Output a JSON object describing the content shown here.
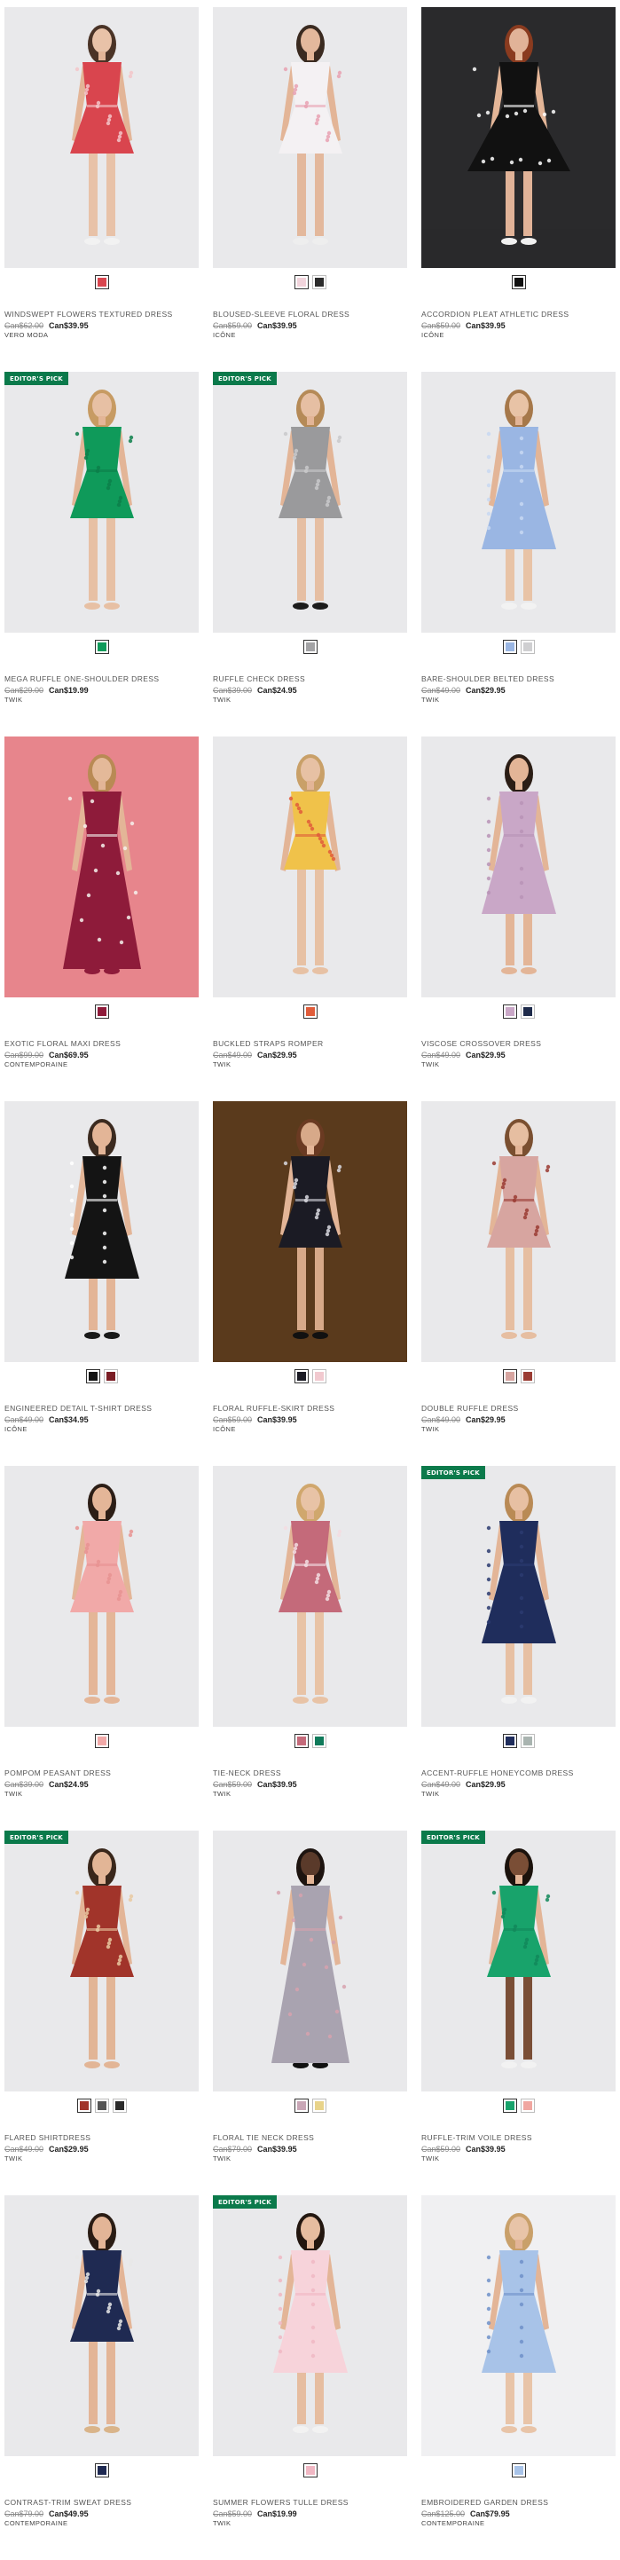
{
  "badge_label": "EDITOR'S PICK",
  "products": [
    {
      "name": "WINDSWEPT FLOWERS TEXTURED DRESS",
      "was": "Can$62.00",
      "now": "Can$39.95",
      "brand": "VERO MODA",
      "editors_pick": false,
      "photo": {
        "bg": "#e9e9eb",
        "dress": "#d9454e",
        "accent": "#f3c6c9",
        "hair": "#4a3326",
        "legs": "#e8c2a8",
        "shoes": "#f2f2f2",
        "style": "short"
      },
      "swatches": [
        "#d9454e"
      ]
    },
    {
      "name": "BLOUSED-SLEEVE FLORAL DRESS",
      "was": "Can$59.00",
      "now": "Can$39.95",
      "brand": "ICÔNE",
      "editors_pick": false,
      "photo": {
        "bg": "#e9e9eb",
        "dress": "#f4f1f3",
        "accent": "#e8a1b2",
        "hair": "#3a2a20",
        "legs": "#e3b89c",
        "shoes": "#eeeeee",
        "style": "short"
      },
      "swatches": [
        "#f1d4dc",
        "#2b2b2b"
      ]
    },
    {
      "name": "ACCORDION PLEAT ATHLETIC DRESS",
      "was": "Can$59.00",
      "now": "Can$39.95",
      "brand": "ICÔNE",
      "editors_pick": false,
      "photo": {
        "bg": "#2a2a2c",
        "dress": "#111111",
        "accent": "#ffffff",
        "hair": "#8a3b1f",
        "legs": "#e1b398",
        "shoes": "#f0f0f0",
        "style": "flare"
      },
      "swatches": [
        "#111111"
      ]
    },
    {
      "name": "MEGA RUFFLE ONE-SHOULDER DRESS",
      "was": "Can$29.00",
      "now": "Can$19.99",
      "brand": "TWIK",
      "editors_pick": true,
      "photo": {
        "bg": "#e9e9eb",
        "dress": "#0f9a5a",
        "accent": "#0c7f4a",
        "hair": "#c79b63",
        "legs": "#e7c0a4",
        "shoes": "#e7c0a4",
        "style": "short"
      },
      "swatches": [
        "#0f9a5a"
      ]
    },
    {
      "name": "RUFFLE CHECK DRESS",
      "was": "Can$39.00",
      "now": "Can$24.95",
      "brand": "TWIK",
      "editors_pick": true,
      "photo": {
        "bg": "#e9e9eb",
        "dress": "#9a9a9c",
        "accent": "#c9c9cb",
        "hair": "#b58a57",
        "legs": "#e6bfa3",
        "shoes": "#1c1c1c",
        "style": "short"
      },
      "swatches": [
        "#a3a3a5"
      ]
    },
    {
      "name": "BARE-SHOULDER BELTED DRESS",
      "was": "Can$49.00",
      "now": "Can$29.95",
      "brand": "TWIK",
      "editors_pick": false,
      "photo": {
        "bg": "#e9e9eb",
        "dress": "#9ab6e3",
        "accent": "#c8d8f2",
        "hair": "#a6784a",
        "legs": "#e8c3a6",
        "shoes": "#f2f2f2",
        "style": "midi"
      },
      "swatches": [
        "#9ab6e3",
        "#cfcfd1"
      ]
    },
    {
      "name": "EXOTIC FLORAL MAXI DRESS",
      "was": "Can$99.00",
      "now": "Can$69.95",
      "brand": "CONTEMPORAINE",
      "editors_pick": false,
      "photo": {
        "bg": "#e7858c",
        "dress": "#8e1b3a",
        "accent": "#f4f1ec",
        "hair": "#b98a54",
        "legs": "#e4b999",
        "shoes": "#8e1b3a",
        "style": "maxi"
      },
      "swatches": [
        "#8e1b3a"
      ]
    },
    {
      "name": "BUCKLED STRAPS ROMPER",
      "was": "Can$49.00",
      "now": "Can$29.95",
      "brand": "TWIK",
      "editors_pick": false,
      "photo": {
        "bg": "#e9e9eb",
        "dress": "#f0c24a",
        "accent": "#e05c3a",
        "hair": "#c9a068",
        "legs": "#e7c1a4",
        "shoes": "#e7c1a4",
        "style": "romper"
      },
      "swatches": [
        "#e05c3a"
      ]
    },
    {
      "name": "VISCOSE CROSSOVER DRESS",
      "was": "Can$49.00",
      "now": "Can$29.95",
      "brand": "TWIK",
      "editors_pick": false,
      "photo": {
        "bg": "#e9e9eb",
        "dress": "#c9a7c7",
        "accent": "#b893b6",
        "hair": "#2b1d15",
        "legs": "#e3b597",
        "shoes": "#e3b597",
        "style": "midi"
      },
      "swatches": [
        "#c9a7c7",
        "#1e2a4a"
      ]
    },
    {
      "name": "ENGINEERED DETAIL T-SHIRT DRESS",
      "was": "Can$49.00",
      "now": "Can$34.95",
      "brand": "ICÔNE",
      "editors_pick": false,
      "photo": {
        "bg": "#e9e9eb",
        "dress": "#141414",
        "accent": "#ffffff",
        "hair": "#3b2a1f",
        "legs": "#e3b597",
        "shoes": "#1a1a1a",
        "style": "midi"
      },
      "swatches": [
        "#141414",
        "#7a1d24"
      ]
    },
    {
      "name": "FLORAL RUFFLE-SKIRT DRESS",
      "was": "Can$59.00",
      "now": "Can$39.95",
      "brand": "ICÔNE",
      "editors_pick": false,
      "photo": {
        "bg": "#5a3a1c",
        "dress": "#1b1b24",
        "accent": "#d9d9e0",
        "hair": "#6a3a22",
        "legs": "#d7a989",
        "shoes": "#111111",
        "style": "short"
      },
      "swatches": [
        "#1b1b24",
        "#f1c9cf"
      ]
    },
    {
      "name": "DOUBLE RUFFLE DRESS",
      "was": "Can$49.00",
      "now": "Can$29.95",
      "brand": "TWIK",
      "editors_pick": false,
      "photo": {
        "bg": "#e9e9eb",
        "dress": "#d7a5a0",
        "accent": "#9a3b33",
        "hair": "#7a4f30",
        "legs": "#e6bea1",
        "shoes": "#e6bea1",
        "style": "short"
      },
      "swatches": [
        "#d7a5a0",
        "#9a3b33"
      ]
    },
    {
      "name": "POMPOM PEASANT DRESS",
      "was": "Can$39.00",
      "now": "Can$24.95",
      "brand": "TWIK",
      "editors_pick": false,
      "photo": {
        "bg": "#e9e9eb",
        "dress": "#f1a9a8",
        "accent": "#e79392",
        "hair": "#2c1e16",
        "legs": "#e4b698",
        "shoes": "#e4b698",
        "style": "short"
      },
      "swatches": [
        "#f1a9a8"
      ]
    },
    {
      "name": "TIE-NECK DRESS",
      "was": "Can$59.00",
      "now": "Can$39.95",
      "brand": "TWIK",
      "editors_pick": false,
      "photo": {
        "bg": "#e9e9eb",
        "dress": "#c46a7a",
        "accent": "#f3dde2",
        "hair": "#d0a76d",
        "legs": "#e8c3a6",
        "shoes": "#e8c3a6",
        "style": "short"
      },
      "swatches": [
        "#c46a7a",
        "#0f7a5a"
      ]
    },
    {
      "name": "ACCENT-RUFFLE HONEYCOMB DRESS",
      "was": "Can$49.00",
      "now": "Can$29.95",
      "brand": "TWIK",
      "editors_pick": true,
      "photo": {
        "bg": "#e9e9eb",
        "dress": "#1f2d5c",
        "accent": "#2b3b70",
        "hair": "#b98a55",
        "legs": "#e7c0a3",
        "shoes": "#f2f2f2",
        "style": "midi"
      },
      "swatches": [
        "#1f2d5c",
        "#a9b4b0"
      ]
    },
    {
      "name": "FLARED SHIRTDRESS",
      "was": "Can$49.00",
      "now": "Can$29.95",
      "brand": "TWIK",
      "editors_pick": true,
      "photo": {
        "bg": "#e9e9eb",
        "dress": "#a1342a",
        "accent": "#e9c9a1",
        "hair": "#3a271b",
        "legs": "#e2b596",
        "shoes": "#e2b596",
        "style": "short"
      },
      "swatches": [
        "#a1342a",
        "#555555",
        "#2a2a2a"
      ]
    },
    {
      "name": "FLORAL TIE NECK DRESS",
      "was": "Can$79.00",
      "now": "Can$39.95",
      "brand": "TWIK",
      "editors_pick": false,
      "photo": {
        "bg": "#e9e9eb",
        "dress": "#a9a3b0",
        "accent": "#d7a2ae",
        "hair": "#1d1410",
        "legs": "#5a3a2a",
        "shoes": "#111111",
        "style": "maxi"
      },
      "swatches": [
        "#c9a6b6",
        "#e8d38a"
      ]
    },
    {
      "name": "RUFFLE-TRIM VOILE DRESS",
      "was": "Can$59.00",
      "now": "Can$39.95",
      "brand": "TWIK",
      "editors_pick": true,
      "photo": {
        "bg": "#e9e9eb",
        "dress": "#18a36b",
        "accent": "#12885a",
        "hair": "#1b120c",
        "legs": "#7a4e36",
        "shoes": "#f2f2f2",
        "style": "short"
      },
      "swatches": [
        "#18a36b",
        "#f0a6a0"
      ]
    },
    {
      "name": "CONTRAST-TRIM SWEAT DRESS",
      "was": "Can$79.00",
      "now": "Can$49.95",
      "brand": "CONTEMPORAINE",
      "editors_pick": false,
      "photo": {
        "bg": "#e9e9eb",
        "dress": "#1f2a52",
        "accent": "#e8e8e8",
        "hair": "#2a1c14",
        "legs": "#e3b597",
        "shoes": "#d9b48a",
        "style": "short"
      },
      "swatches": [
        "#1f2a52"
      ]
    },
    {
      "name": "SUMMER FLOWERS TULLE DRESS",
      "was": "Can$59.00",
      "now": "Can$19.99",
      "brand": "TWIK",
      "editors_pick": true,
      "photo": {
        "bg": "#e9e9eb",
        "dress": "#f7d3da",
        "accent": "#f0b7c3",
        "hair": "#231710",
        "legs": "#e6bda0",
        "shoes": "#f2f2f2",
        "style": "midi"
      },
      "swatches": [
        "#f0b7c3"
      ]
    },
    {
      "name": "EMBROIDERED GARDEN DRESS",
      "was": "Can$125.00",
      "now": "Can$79.95",
      "brand": "CONTEMPORAINE",
      "editors_pick": false,
      "photo": {
        "bg": "#f0f0f2",
        "dress": "#a8c3e8",
        "accent": "#6f91c9",
        "hair": "#c9a06a",
        "legs": "#e8c4a8",
        "shoes": "#e8c4a8",
        "style": "midi"
      },
      "swatches": [
        "#a8c3e8"
      ]
    }
  ]
}
